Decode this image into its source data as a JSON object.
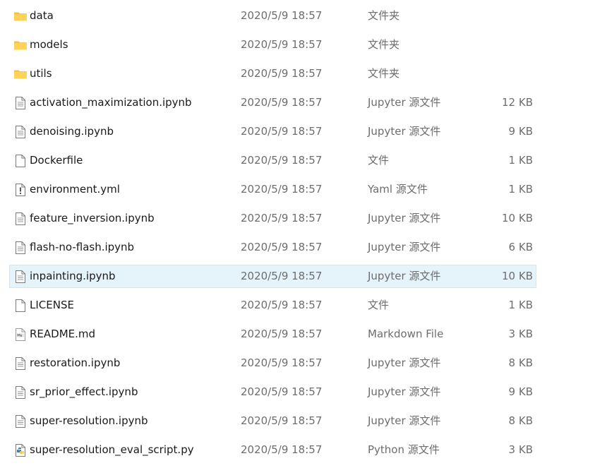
{
  "files": [
    {
      "name": "data",
      "date": "2020/5/9 18:57",
      "type": "文件夹",
      "size": "",
      "icon": "folder-icon"
    },
    {
      "name": "models",
      "date": "2020/5/9 18:57",
      "type": "文件夹",
      "size": "",
      "icon": "folder-icon"
    },
    {
      "name": "utils",
      "date": "2020/5/9 18:57",
      "type": "文件夹",
      "size": "",
      "icon": "folder-icon"
    },
    {
      "name": "activation_maximization.ipynb",
      "date": "2020/5/9 18:57",
      "type": "Jupyter 源文件",
      "size": "12 KB",
      "icon": "text-file-icon"
    },
    {
      "name": "denoising.ipynb",
      "date": "2020/5/9 18:57",
      "type": "Jupyter 源文件",
      "size": "9 KB",
      "icon": "text-file-icon"
    },
    {
      "name": "Dockerfile",
      "date": "2020/5/9 18:57",
      "type": "文件",
      "size": "1 KB",
      "icon": "blank-file-icon"
    },
    {
      "name": "environment.yml",
      "date": "2020/5/9 18:57",
      "type": "Yaml 源文件",
      "size": "1 KB",
      "icon": "yaml-file-icon"
    },
    {
      "name": "feature_inversion.ipynb",
      "date": "2020/5/9 18:57",
      "type": "Jupyter 源文件",
      "size": "10 KB",
      "icon": "text-file-icon"
    },
    {
      "name": "flash-no-flash.ipynb",
      "date": "2020/5/9 18:57",
      "type": "Jupyter 源文件",
      "size": "6 KB",
      "icon": "text-file-icon"
    },
    {
      "name": "inpainting.ipynb",
      "date": "2020/5/9 18:57",
      "type": "Jupyter 源文件",
      "size": "10 KB",
      "icon": "text-file-icon",
      "selected": true
    },
    {
      "name": "LICENSE",
      "date": "2020/5/9 18:57",
      "type": "文件",
      "size": "1 KB",
      "icon": "blank-file-icon"
    },
    {
      "name": "README.md",
      "date": "2020/5/9 18:57",
      "type": "Markdown File",
      "size": "3 KB",
      "icon": "markdown-file-icon"
    },
    {
      "name": "restoration.ipynb",
      "date": "2020/5/9 18:57",
      "type": "Jupyter 源文件",
      "size": "8 KB",
      "icon": "text-file-icon"
    },
    {
      "name": "sr_prior_effect.ipynb",
      "date": "2020/5/9 18:57",
      "type": "Jupyter 源文件",
      "size": "9 KB",
      "icon": "text-file-icon"
    },
    {
      "name": "super-resolution.ipynb",
      "date": "2020/5/9 18:57",
      "type": "Jupyter 源文件",
      "size": "8 KB",
      "icon": "text-file-icon"
    },
    {
      "name": "super-resolution_eval_script.py",
      "date": "2020/5/9 18:57",
      "type": "Python 源文件",
      "size": "3 KB",
      "icon": "python-file-icon"
    }
  ],
  "colors": {
    "selection_background": "#e5f3fb",
    "selection_border": "#cfe6f5",
    "folder_yellow": "#ffd25a",
    "python_blue": "#3a75b0",
    "python_yellow": "#f6cf3f"
  }
}
